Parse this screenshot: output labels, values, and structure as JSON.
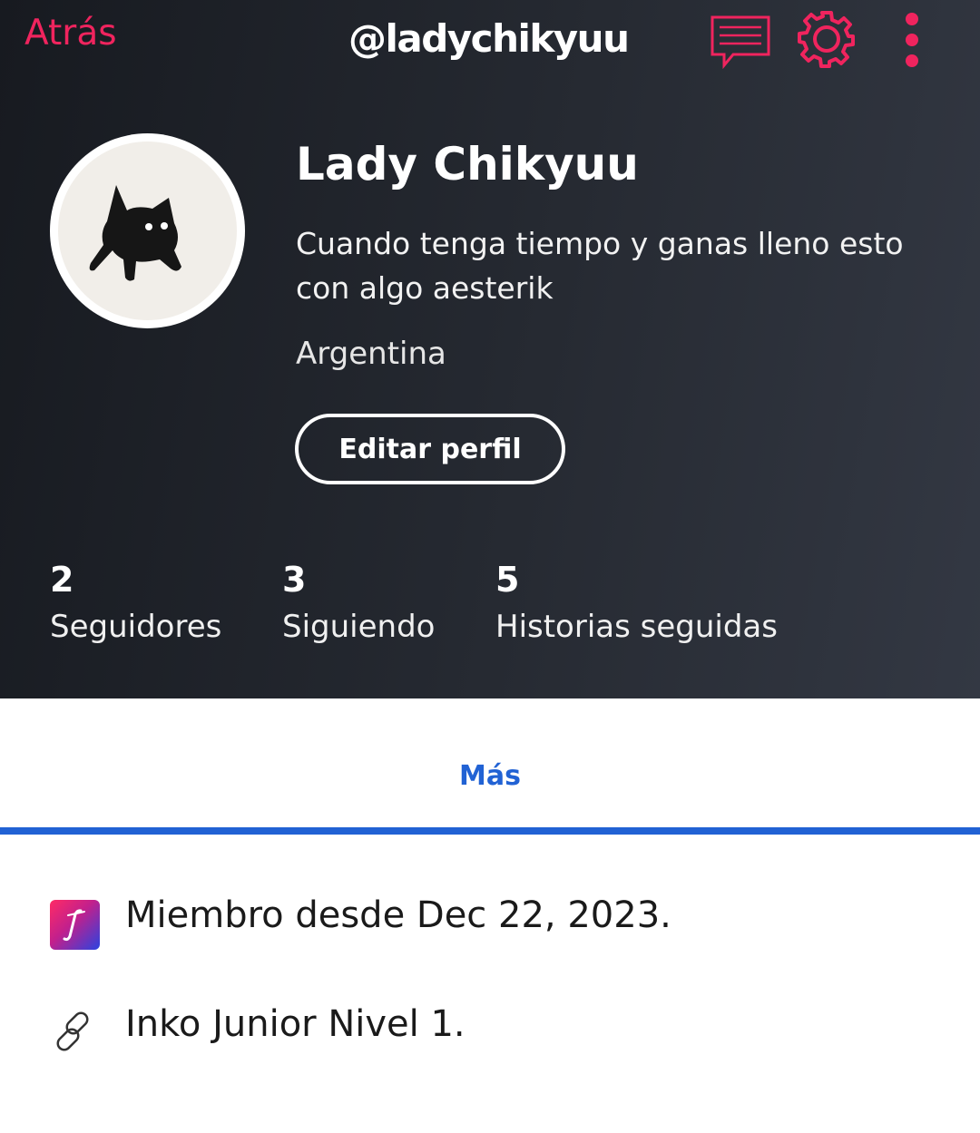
{
  "topbar": {
    "back_label": "Atrás",
    "username": "@ladychikyuu",
    "accent_color": "#f0245e",
    "icons": [
      "messages-icon",
      "settings-gear-icon",
      "more-vertical-icon"
    ]
  },
  "profile": {
    "display_name": "Lady Chikyuu",
    "bio": "Cuando tenga tiempo y ganas lleno esto con algo aesterik",
    "location": "Argentina",
    "edit_button": "Editar perfil",
    "avatar_icon": "black-cat-avatar"
  },
  "stats": [
    {
      "count": "2",
      "label": "Seguidores"
    },
    {
      "count": "3",
      "label": "Siguiendo"
    },
    {
      "count": "5",
      "label": "Historias seguidas"
    }
  ],
  "tabs": {
    "active_label": "Más",
    "active_color": "#2162d4"
  },
  "info": {
    "member_since": "Miembro desde Dec 22, 2023.",
    "level": "Inko Junior Nivel 1.",
    "icons": [
      "inkspired-badge-icon",
      "link-icon"
    ]
  }
}
